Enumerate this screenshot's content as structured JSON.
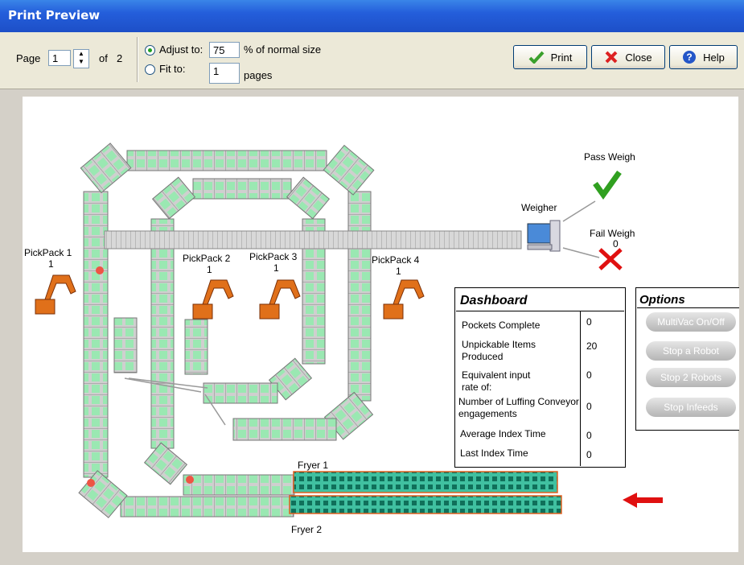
{
  "window": {
    "title": "Print Preview"
  },
  "toolbar": {
    "page_label": "Page",
    "page_value": "1",
    "of_label": "of",
    "page_count": "2",
    "adjust_label": "Adjust to:",
    "adjust_value": "75",
    "normal_size_label": "% of normal size",
    "fit_label": "Fit to:",
    "fit_value": "1",
    "pages_label": "pages",
    "print_label": "Print",
    "close_label": "Close",
    "help_label": "Help"
  },
  "diagram": {
    "pickpack1": "PickPack 1",
    "pickpack1_count": "1",
    "pickpack2": "PickPack 2",
    "pickpack2_count": "1",
    "pickpack3": "PickPack 3",
    "pickpack3_count": "1",
    "pickpack4": "PickPack 4",
    "pickpack4_count": "1",
    "weigher": "Weigher",
    "pass_weigh": "Pass Weigh",
    "fail_weigh": "Fail Weigh",
    "fail_count": "0",
    "fryer1": "Fryer 1",
    "fryer2": "Fryer 2"
  },
  "dashboard": {
    "title": "Dashboard",
    "rows": [
      {
        "label": "Pockets Complete",
        "value": "0"
      },
      {
        "label": "Unpickable Items Produced",
        "value": "20"
      },
      {
        "label": "Equivalent input rate of:",
        "value": "0"
      },
      {
        "label": "Number of Luffing Conveyor engagements",
        "value": "0"
      },
      {
        "label": "Average Index Time",
        "value": "0"
      },
      {
        "label": "Last Index Time",
        "value": "0"
      }
    ]
  },
  "options": {
    "title": "Options",
    "buttons": [
      "MultiVac On/Off",
      "Stop a Robot",
      "Stop 2 Robots",
      "Stop Infeeds"
    ]
  },
  "colors": {
    "accent": "#245edb",
    "belt": "#c8c8c8",
    "pocket": "#8ef0a8",
    "alarm": "#e01010",
    "fryer_border": "#e06020"
  }
}
